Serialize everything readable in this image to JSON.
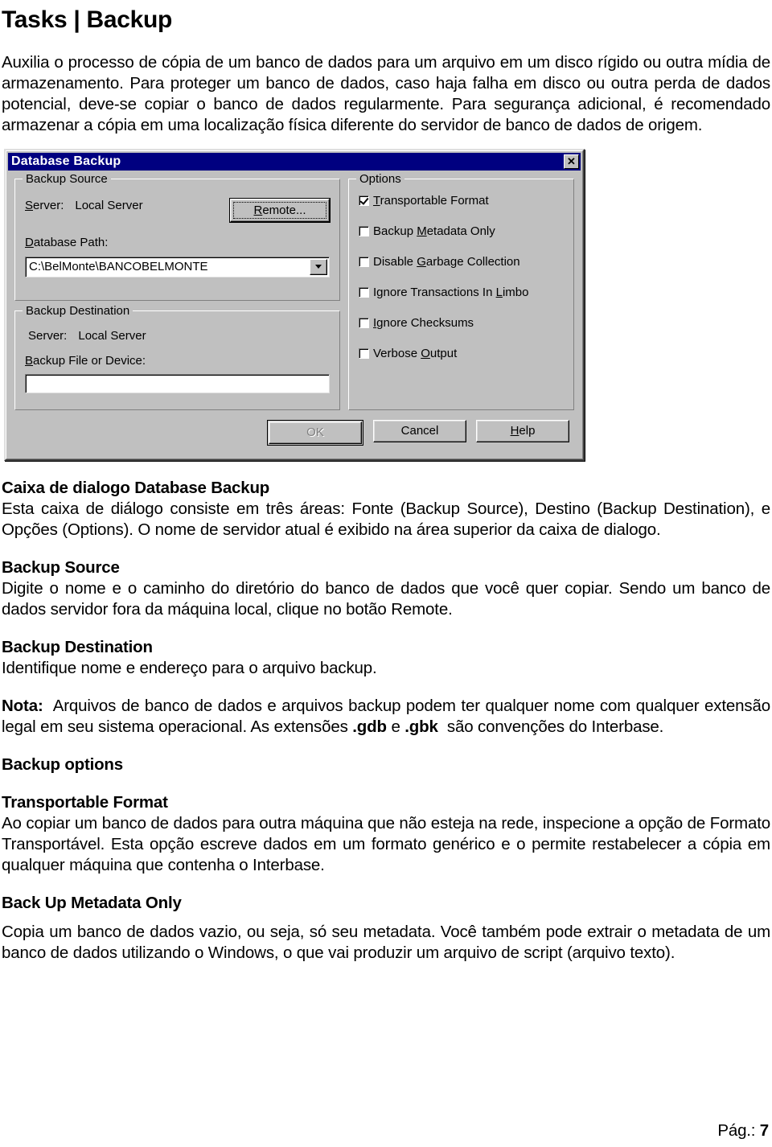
{
  "document": {
    "title": "Tasks | Backup",
    "intro_paragraph": "Auxilia o processo de cópia de um banco de dados para um arquivo em um disco rígido ou outra mídia de armazenamento. Para proteger um banco de dados, caso haja falha em disco ou outra perda de dados potencial, deve-se copiar o banco de dados regularmente. Para segurança adicional, é recomendado armazenar a cópia em uma localização física diferente do servidor de banco de dados de origem.",
    "sections": [
      {
        "heading": "Caixa de dialogo Database Backup",
        "body": "Esta caixa de diálogo consiste em três áreas: Fonte (Backup Source), Destino (Backup Destination), e Opções (Options). O nome de servidor atual é exibido na área superior da caixa de dialogo."
      },
      {
        "heading": "Backup Source",
        "body": "Digite o nome e o caminho do diretório do banco de dados que você quer copiar. Sendo um banco de dados servidor fora da máquina local, clique no botão Remote."
      },
      {
        "heading": "Backup Destination",
        "body": "Identifique nome e endereço para o arquivo backup."
      }
    ],
    "note": {
      "label": "Nota:",
      "text_before": "Arquivos de banco de dados e arquivos backup podem ter qualquer nome com qualquer extensão legal em seu sistema operacional. As extensões",
      "ext_one": ".gdb",
      "conjunction": "e",
      "ext_two": ".gbk",
      "text_after": "são convenções do Interbase."
    },
    "options_sections": [
      {
        "heading": "Backup options",
        "body": ""
      },
      {
        "heading": "Transportable Format",
        "body": "Ao copiar um banco de dados para outra máquina que não esteja na rede, inspecione a opção de Formato Transportável. Esta opção escreve dados em um formato genérico e o permite restabelecer a cópia em qualquer máquina que contenha o Interbase."
      },
      {
        "heading": "Back Up Metadata Only",
        "body": "Copia um banco de dados vazio, ou seja, só seu metadata. Você também pode extrair o metadata de um banco de dados utilizando o Windows, o que vai produzir um arquivo de script (arquivo texto)."
      }
    ],
    "footer": {
      "label": "Pág.:",
      "page_number": "7"
    }
  },
  "dialog": {
    "title": "Database Backup",
    "close_icon": "close-icon",
    "close_glyph": "✕",
    "titlebar_color": "#000080",
    "face_color": "#c0c0c0",
    "backup_source": {
      "legend": "Backup Source",
      "server_label_mn": "S",
      "server_label_rest": "erver:",
      "server_value": "Local Server",
      "remote_button_mn": "R",
      "remote_button_rest": "emote...",
      "path_label_mn": "D",
      "path_label_rest": "atabase Path:",
      "path_value": "C:\\BelMonte\\BANCOBELMONTE",
      "path_placeholder": "Database path"
    },
    "backup_destination": {
      "legend": "Backup Destination",
      "server_label": "Server:",
      "server_value": "Local Server",
      "file_label_mn": "B",
      "file_label_rest": "ackup File or Device:",
      "file_value": "",
      "file_placeholder": ""
    },
    "options": {
      "legend": "Options",
      "items": [
        {
          "pre": "",
          "mn": "T",
          "post": "ransportable Format",
          "checked": true
        },
        {
          "pre": "Backup ",
          "mn": "M",
          "post": "etadata Only",
          "checked": false
        },
        {
          "pre": "Disable ",
          "mn": "G",
          "post": "arbage Collection",
          "checked": false
        },
        {
          "pre": "Ignore Transactions In ",
          "mn": "L",
          "post": "imbo",
          "checked": false
        },
        {
          "pre": "",
          "mn": "I",
          "post": "gnore Checksums",
          "checked": false
        },
        {
          "pre": "Verbose ",
          "mn": "O",
          "post": "utput",
          "checked": false
        }
      ]
    },
    "buttons": {
      "ok": {
        "label": "OK",
        "disabled": true,
        "default": true
      },
      "cancel": {
        "label": "Cancel",
        "disabled": false
      },
      "help": {
        "mn": "H",
        "rest": "elp",
        "disabled": false
      }
    }
  }
}
